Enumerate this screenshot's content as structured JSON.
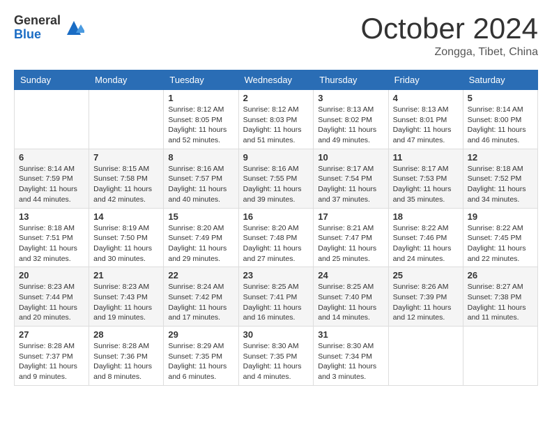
{
  "header": {
    "logo_general": "General",
    "logo_blue": "Blue",
    "month_title": "October 2024",
    "subtitle": "Zongga, Tibet, China"
  },
  "calendar": {
    "days": [
      "Sunday",
      "Monday",
      "Tuesday",
      "Wednesday",
      "Thursday",
      "Friday",
      "Saturday"
    ],
    "weeks": [
      [
        {
          "day": "",
          "content": ""
        },
        {
          "day": "",
          "content": ""
        },
        {
          "day": "1",
          "content": "Sunrise: 8:12 AM\nSunset: 8:05 PM\nDaylight: 11 hours and 52 minutes."
        },
        {
          "day": "2",
          "content": "Sunrise: 8:12 AM\nSunset: 8:03 PM\nDaylight: 11 hours and 51 minutes."
        },
        {
          "day": "3",
          "content": "Sunrise: 8:13 AM\nSunset: 8:02 PM\nDaylight: 11 hours and 49 minutes."
        },
        {
          "day": "4",
          "content": "Sunrise: 8:13 AM\nSunset: 8:01 PM\nDaylight: 11 hours and 47 minutes."
        },
        {
          "day": "5",
          "content": "Sunrise: 8:14 AM\nSunset: 8:00 PM\nDaylight: 11 hours and 46 minutes."
        }
      ],
      [
        {
          "day": "6",
          "content": "Sunrise: 8:14 AM\nSunset: 7:59 PM\nDaylight: 11 hours and 44 minutes."
        },
        {
          "day": "7",
          "content": "Sunrise: 8:15 AM\nSunset: 7:58 PM\nDaylight: 11 hours and 42 minutes."
        },
        {
          "day": "8",
          "content": "Sunrise: 8:16 AM\nSunset: 7:57 PM\nDaylight: 11 hours and 40 minutes."
        },
        {
          "day": "9",
          "content": "Sunrise: 8:16 AM\nSunset: 7:55 PM\nDaylight: 11 hours and 39 minutes."
        },
        {
          "day": "10",
          "content": "Sunrise: 8:17 AM\nSunset: 7:54 PM\nDaylight: 11 hours and 37 minutes."
        },
        {
          "day": "11",
          "content": "Sunrise: 8:17 AM\nSunset: 7:53 PM\nDaylight: 11 hours and 35 minutes."
        },
        {
          "day": "12",
          "content": "Sunrise: 8:18 AM\nSunset: 7:52 PM\nDaylight: 11 hours and 34 minutes."
        }
      ],
      [
        {
          "day": "13",
          "content": "Sunrise: 8:18 AM\nSunset: 7:51 PM\nDaylight: 11 hours and 32 minutes."
        },
        {
          "day": "14",
          "content": "Sunrise: 8:19 AM\nSunset: 7:50 PM\nDaylight: 11 hours and 30 minutes."
        },
        {
          "day": "15",
          "content": "Sunrise: 8:20 AM\nSunset: 7:49 PM\nDaylight: 11 hours and 29 minutes."
        },
        {
          "day": "16",
          "content": "Sunrise: 8:20 AM\nSunset: 7:48 PM\nDaylight: 11 hours and 27 minutes."
        },
        {
          "day": "17",
          "content": "Sunrise: 8:21 AM\nSunset: 7:47 PM\nDaylight: 11 hours and 25 minutes."
        },
        {
          "day": "18",
          "content": "Sunrise: 8:22 AM\nSunset: 7:46 PM\nDaylight: 11 hours and 24 minutes."
        },
        {
          "day": "19",
          "content": "Sunrise: 8:22 AM\nSunset: 7:45 PM\nDaylight: 11 hours and 22 minutes."
        }
      ],
      [
        {
          "day": "20",
          "content": "Sunrise: 8:23 AM\nSunset: 7:44 PM\nDaylight: 11 hours and 20 minutes."
        },
        {
          "day": "21",
          "content": "Sunrise: 8:23 AM\nSunset: 7:43 PM\nDaylight: 11 hours and 19 minutes."
        },
        {
          "day": "22",
          "content": "Sunrise: 8:24 AM\nSunset: 7:42 PM\nDaylight: 11 hours and 17 minutes."
        },
        {
          "day": "23",
          "content": "Sunrise: 8:25 AM\nSunset: 7:41 PM\nDaylight: 11 hours and 16 minutes."
        },
        {
          "day": "24",
          "content": "Sunrise: 8:25 AM\nSunset: 7:40 PM\nDaylight: 11 hours and 14 minutes."
        },
        {
          "day": "25",
          "content": "Sunrise: 8:26 AM\nSunset: 7:39 PM\nDaylight: 11 hours and 12 minutes."
        },
        {
          "day": "26",
          "content": "Sunrise: 8:27 AM\nSunset: 7:38 PM\nDaylight: 11 hours and 11 minutes."
        }
      ],
      [
        {
          "day": "27",
          "content": "Sunrise: 8:28 AM\nSunset: 7:37 PM\nDaylight: 11 hours and 9 minutes."
        },
        {
          "day": "28",
          "content": "Sunrise: 8:28 AM\nSunset: 7:36 PM\nDaylight: 11 hours and 8 minutes."
        },
        {
          "day": "29",
          "content": "Sunrise: 8:29 AM\nSunset: 7:35 PM\nDaylight: 11 hours and 6 minutes."
        },
        {
          "day": "30",
          "content": "Sunrise: 8:30 AM\nSunset: 7:35 PM\nDaylight: 11 hours and 4 minutes."
        },
        {
          "day": "31",
          "content": "Sunrise: 8:30 AM\nSunset: 7:34 PM\nDaylight: 11 hours and 3 minutes."
        },
        {
          "day": "",
          "content": ""
        },
        {
          "day": "",
          "content": ""
        }
      ]
    ]
  }
}
